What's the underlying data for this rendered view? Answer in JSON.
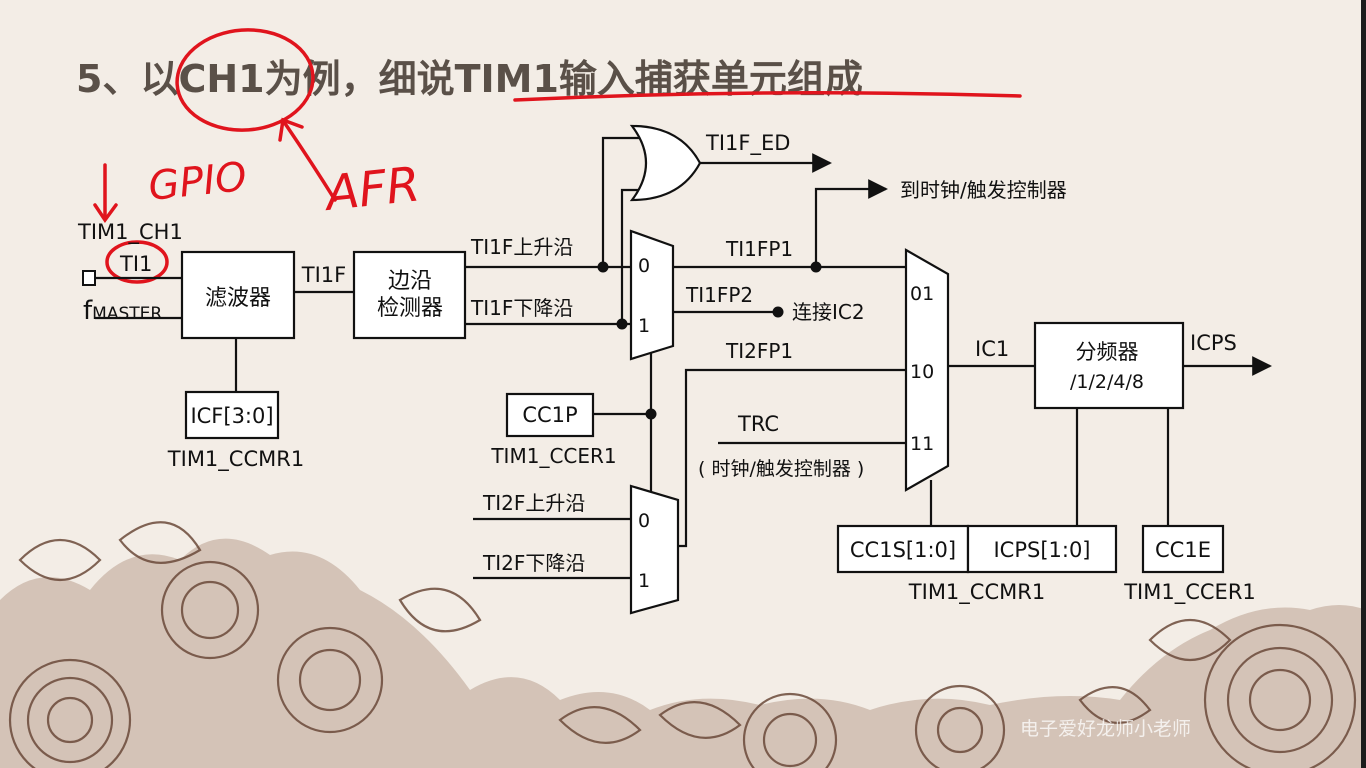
{
  "slide": {
    "title": "5、以CH1为例，细说TIM1输入捕获单元组成",
    "annotations": [
      "GPIO",
      "AFR"
    ],
    "watermark": "电子爱好龙师小老师"
  },
  "diagram": {
    "pin": {
      "name": "TIM1_CH1",
      "signal": "TI1",
      "clock": "f",
      "clock_sub": "MASTER"
    },
    "filter": {
      "label": "滤波器",
      "reg_field": "ICF[3:0]",
      "register": "TIM1_CCMR1"
    },
    "ti1f_label": "TI1F",
    "edge_detector": {
      "line1": "边沿",
      "line2": "检测器"
    },
    "ti1f_rising": "TI1F上升沿",
    "ti1f_falling": "TI1F下降沿",
    "ti1f_ed": "TI1F_ED",
    "to_controller": "到时钟/触发控制器",
    "mux1": {
      "in0": "0",
      "in1": "1"
    },
    "ti1fp1": "TI1FP1",
    "ti1fp2": "TI1FP2",
    "connect_ic2": "连接IC2",
    "cc1p": {
      "label": "CC1P",
      "register": "TIM1_CCER1"
    },
    "ti2fp1": "TI2FP1",
    "ti2f_rising": "TI2F上升沿",
    "ti2f_falling": "TI2F下降沿",
    "mux2": {
      "in0": "0",
      "in1": "1"
    },
    "trc": "TRC",
    "trc_note": "( 时钟/触发控制器 )",
    "mux3": {
      "in01": "01",
      "in10": "10",
      "in11": "11"
    },
    "ic1": "IC1",
    "prescaler": {
      "line1": "分频器",
      "line2": "/1/2/4/8"
    },
    "icps_out": "ICPS",
    "cc1s": "CC1S[1:0]",
    "icps_field": "ICPS[1:0]",
    "ccmr1_register": "TIM1_CCMR1",
    "cc1e": "CC1E",
    "ccer1_register": "TIM1_CCER1"
  }
}
